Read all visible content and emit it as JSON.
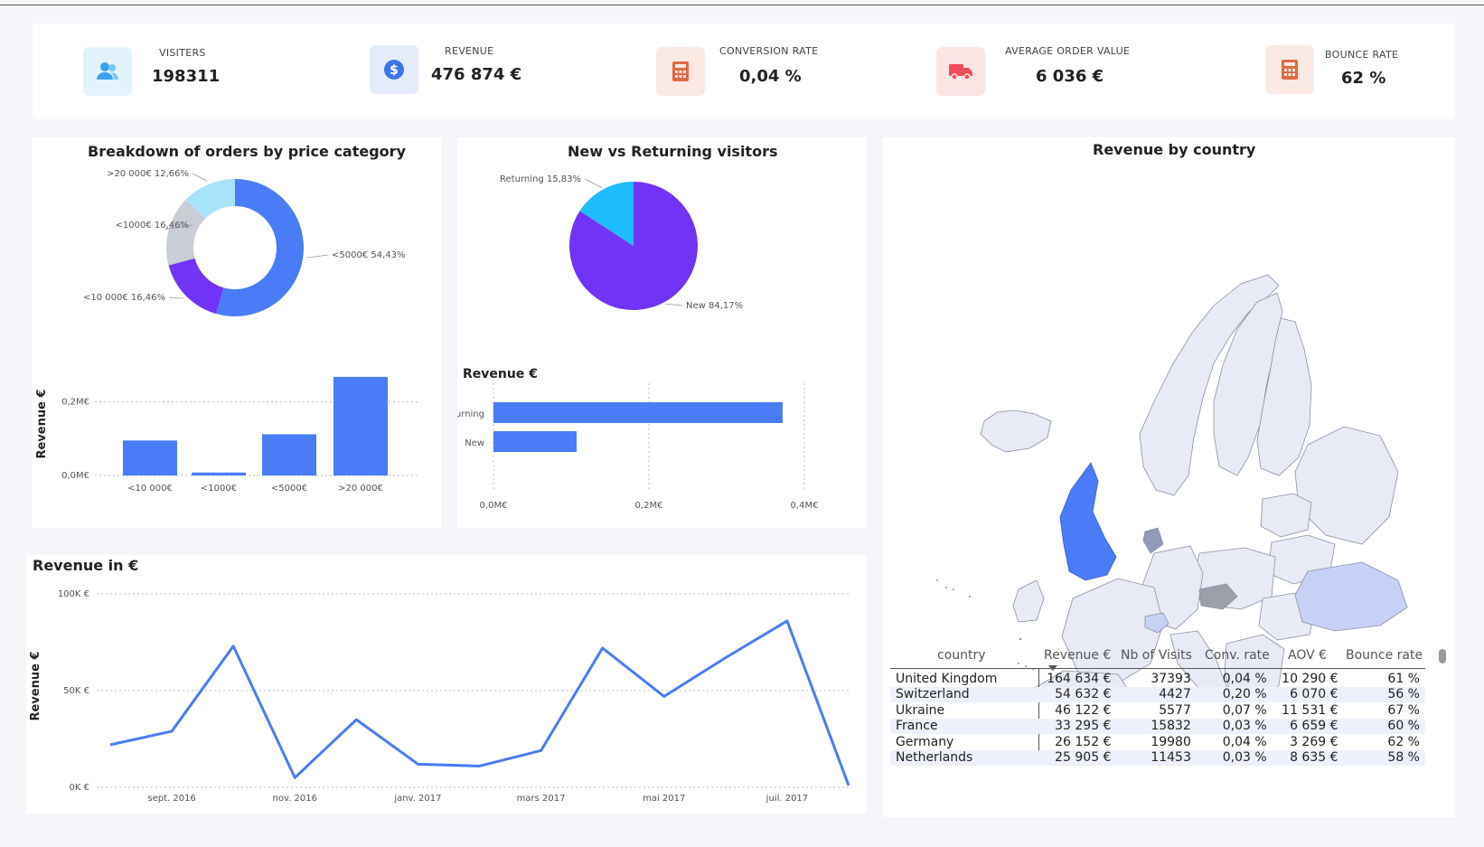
{
  "kpis": [
    {
      "label": "VISITERS",
      "value": "198311",
      "icon": "users-icon",
      "color": "#e3f3fb"
    },
    {
      "label": "REVENUE",
      "value": "476 874 €",
      "icon": "dollar-icon",
      "color": "#e4ecfb"
    },
    {
      "label": "CONVERSION RATE",
      "value": "0,04 %",
      "icon": "calculator-icon",
      "color": "#fbe9e4"
    },
    {
      "label": "AVERAGE ORDER VALUE",
      "value": "6 036 €",
      "icon": "truck-icon",
      "color": "#fbe4e4"
    },
    {
      "label": "BOUNCE RATE",
      "value": "62 %",
      "icon": "calculator-icon",
      "color": "#fbe9e4"
    }
  ],
  "panels": {
    "price_title": "Breakdown of orders by price category",
    "visitors_title": "New vs Returning visitors",
    "country_title": "Revenue by country",
    "revenue_bar_title": "Revenue €",
    "revenue_line_title": "Revenue in €"
  },
  "colors": {
    "primary": "#4a7cf7",
    "purple": "#7133f5",
    "cyan": "#1fbdfd",
    "light": "#c9cdd6",
    "lightcyan": "#a8e3fc"
  },
  "chart_data": [
    {
      "type": "pie",
      "variant": "donut",
      "slices": [
        {
          "label": "<5000€",
          "value": 54.43,
          "text": "<5000€ 54,43%"
        },
        {
          "label": "<10 000€",
          "value": 16.46,
          "text": "<10 000€ 16,46%"
        },
        {
          "label": "<1000€",
          "value": 16.46,
          "text": "<1000€ 16,46%"
        },
        {
          "label": ">20 000€",
          "value": 12.66,
          "text": ">20 000€ 12,66%"
        }
      ]
    },
    {
      "type": "bar",
      "categories": [
        "<10 000€",
        "<1000€",
        "<5000€",
        ">20 000€"
      ],
      "values": [
        0.095,
        0.008,
        0.112,
        0.268
      ],
      "ylabel": "Revenue €",
      "yticks": [
        "0,0M€",
        "0,2M€"
      ],
      "ylim": [
        0,
        0.28
      ]
    },
    {
      "type": "pie",
      "slices": [
        {
          "label": "New",
          "value": 84.17,
          "text": "New 84,17%"
        },
        {
          "label": "Returning",
          "value": 15.83,
          "text": "Returning 15,83%"
        }
      ]
    },
    {
      "type": "bar",
      "orientation": "horizontal",
      "categories": [
        "Returning",
        "New"
      ],
      "values": [
        0.372,
        0.107
      ],
      "xticks": [
        "0,0M€",
        "0,2M€",
        "0,4M€"
      ],
      "xlim": [
        0,
        0.4
      ]
    },
    {
      "type": "line",
      "x": [
        "août 2016",
        "sept. 2016",
        "oct. 2016",
        "nov. 2016",
        "déc. 2016",
        "janv. 2017",
        "févr. 2017",
        "mars 2017",
        "avr. 2017",
        "mai 2017",
        "juin 2017",
        "juil. 2017",
        "août 2017"
      ],
      "y": [
        22,
        29,
        73,
        5,
        35,
        12,
        11,
        19,
        72,
        47,
        67,
        86,
        1
      ],
      "xticks": [
        "sept. 2016",
        "nov. 2016",
        "janv. 2017",
        "mars 2017",
        "mai 2017",
        "juil. 2017"
      ],
      "yticks": [
        "0K €",
        "50K €",
        "100K €"
      ],
      "ylabel": "Revenue €",
      "ylim": [
        0,
        100
      ]
    }
  ],
  "table": {
    "headers": [
      "country",
      "Revenue €",
      "Nb of Visits",
      "Conv. rate",
      "AOV €",
      "Bounce rate"
    ],
    "rows": [
      [
        "United Kingdom",
        "164 634 €",
        "37393",
        "0,04 %",
        "10 290 €",
        "61 %"
      ],
      [
        "Switzerland",
        "54 632 €",
        "4427",
        "0,20 %",
        "6 070 €",
        "56 %"
      ],
      [
        "Ukraine",
        "46 122 €",
        "5577",
        "0,07 %",
        "11 531 €",
        "67 %"
      ],
      [
        "France",
        "33 295 €",
        "15832",
        "0,03 %",
        "6 659 €",
        "60 %"
      ],
      [
        "Germany",
        "26 152 €",
        "19980",
        "0,04 %",
        "3 269 €",
        "62 %"
      ],
      [
        "Netherlands",
        "25 905 €",
        "11453",
        "0,03 %",
        "8 635 €",
        "58 %"
      ]
    ]
  }
}
